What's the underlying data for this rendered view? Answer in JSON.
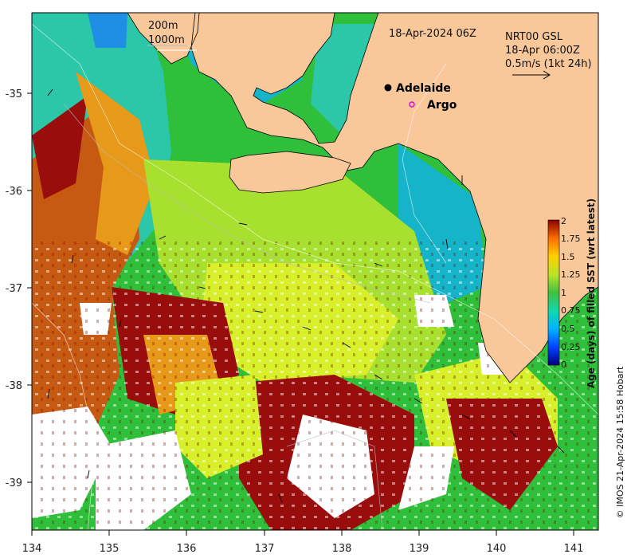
{
  "map": {
    "date_label": "18-Apr-2024 06Z",
    "product": {
      "line1": "NRT00 GSL",
      "line2": "18-Apr 06:00Z",
      "scale_text": "0.5m/s (1kt 24h)"
    },
    "isobath_legend": {
      "shallow": "200m",
      "deep": "1000m"
    },
    "places": {
      "city": "Adelaide",
      "argo": "Argo"
    },
    "x_ticks": [
      "134",
      "135",
      "136",
      "137",
      "138",
      "139",
      "140",
      "141"
    ],
    "y_ticks": [
      "-35",
      "-36",
      "-37",
      "-38",
      "-39"
    ],
    "colorbar": {
      "title": "Age (days) of filled SST (wrt latest)",
      "ticks": [
        "0",
        "0.25",
        "0.5",
        "0.75",
        "1",
        "1.25",
        "1.5",
        "1.75",
        "2"
      ],
      "colors": [
        "#00007f",
        "#0060ff",
        "#00c8ff",
        "#20e0a0",
        "#40c040",
        "#a8e030",
        "#ffd000",
        "#ff7000",
        "#8b0000"
      ]
    },
    "credit": "© IMOS 21-Apr-2024 15:58 Hobart",
    "colors": {
      "land": "#f8c79a",
      "no_data": "#ffffff",
      "dark_red": "#9a0d0d",
      "brown": "#c65a12",
      "orange": "#e79a1a",
      "yellow_green": "#d8ef2c",
      "light_green": "#7edc3a",
      "green": "#2fbf3a",
      "teal": "#2bc7a8",
      "cyan": "#16b4c8",
      "blue": "#1f8fe6"
    }
  }
}
